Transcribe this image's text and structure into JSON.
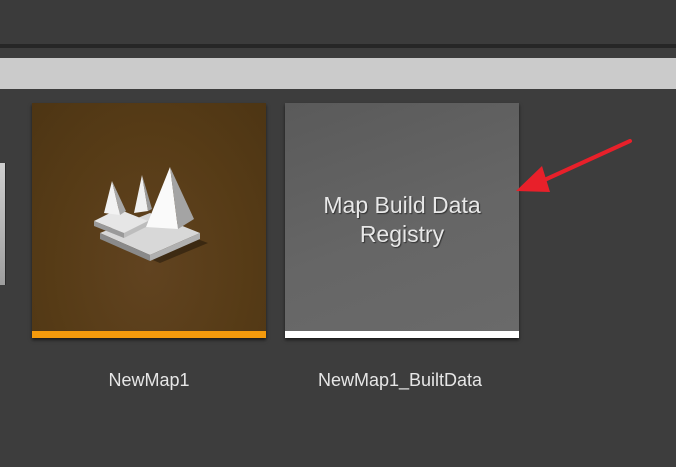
{
  "content_browser": {
    "assets": [
      {
        "name": "NewMap1",
        "type_color": "#f49a0c",
        "icon": "level-map-icon"
      },
      {
        "name": "NewMap1_BuiltData",
        "thumbnail_label": "Map Build Data\nRegistry",
        "type_color": "#ffffff"
      }
    ]
  },
  "annotation": {
    "arrow_color": "#e8202a"
  }
}
